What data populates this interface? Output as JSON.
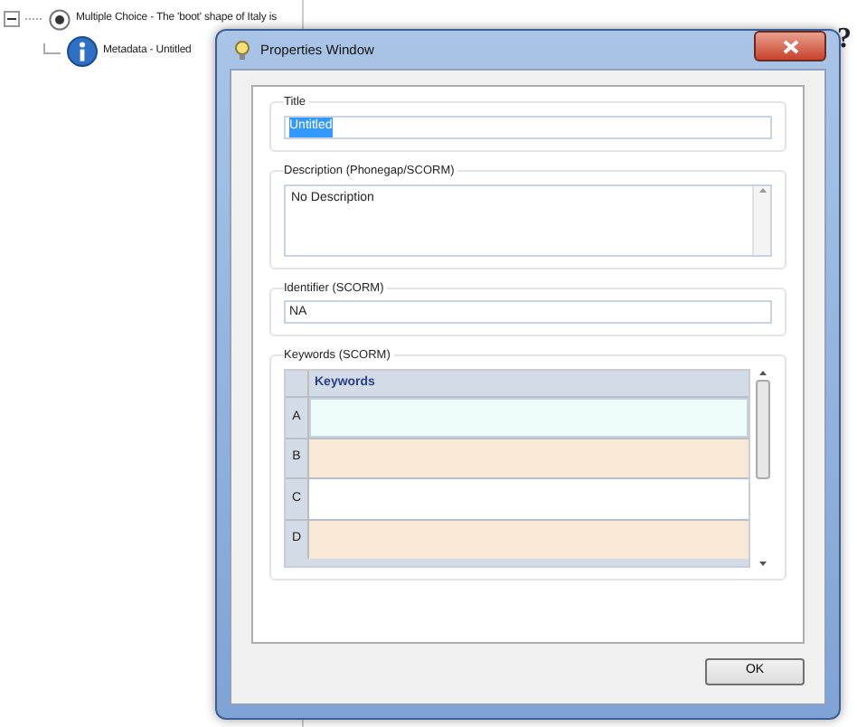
{
  "tree": [
    {
      "label": "Multiple Choice - The 'boot' shape of Italy is",
      "kind": "radio",
      "expanded": true,
      "children": [
        {
          "label": "Metadata - Untitled",
          "kind": "info"
        }
      ]
    }
  ],
  "background_text": [
    "?"
  ],
  "dialog": {
    "title": "Properties Window",
    "fields": [
      {
        "label": "Title",
        "kind": "input",
        "value": "Untitled",
        "text_selected": true
      },
      {
        "label": "Description (Phonegap/SCORM)",
        "kind": "textarea",
        "value": "No Description"
      },
      {
        "label": "Identifier (SCORM)",
        "kind": "input",
        "value": "NA",
        "text_selected": false
      },
      {
        "label": "Keywords (SCORM)",
        "kind": "grid",
        "columns": [
          "Keywords"
        ],
        "rows": [
          {
            "header": "A",
            "selected": true
          },
          {
            "header": "B",
            "selected": false
          },
          {
            "header": "C",
            "selected": false
          },
          {
            "header": "D",
            "selected": false
          }
        ]
      }
    ],
    "buttons": [
      "OK"
    ]
  }
}
